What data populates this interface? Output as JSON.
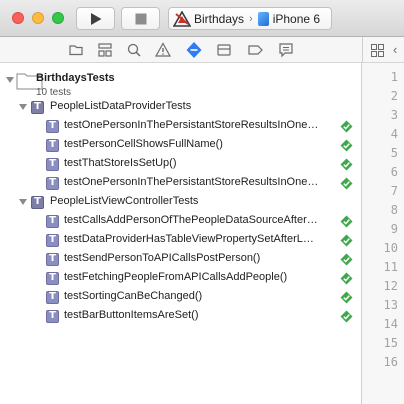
{
  "toolbar": {
    "scheme_name": "Birthdays",
    "device_name": "iPhone 6"
  },
  "navigator_icons": [
    "folder-icon",
    "hierarchy-icon",
    "magnifier-icon",
    "warning-icon",
    "test-diamond-icon",
    "debug-icon",
    "breakpoint-icon",
    "report-icon"
  ],
  "project": {
    "name": "BirthdaysTests",
    "count_label": "10 tests"
  },
  "groups": [
    {
      "name": "PeopleListDataProviderTests",
      "tests": [
        "testOnePersonInThePersistantStoreResultsInOne…",
        "testPersonCellShowsFullName()",
        "testThatStoreIsSetUp()",
        "testOnePersonInThePersistantStoreResultsInOne…"
      ]
    },
    {
      "name": "PeopleListViewControllerTests",
      "tests": [
        "testCallsAddPersonOfThePeopleDataSourceAfter…",
        "testDataProviderHasTableViewPropertySetAfterL…",
        "testSendPersonToAPICallsPostPerson()",
        "testFetchingPeopleFromAPICallsAddPeople()",
        "testSortingCanBeChanged()",
        "testBarButtonItemsAreSet()"
      ]
    }
  ],
  "line_numbers": [
    "1",
    "2",
    "3",
    "4",
    "5",
    "6",
    "7",
    "8",
    "9",
    "10",
    "11",
    "12",
    "13",
    "14",
    "15",
    "16"
  ],
  "colors": {
    "pass_green": "#3fa84c",
    "active_icon_blue": "#2f7cf6",
    "test_icon_purple": "#8b8ec0"
  }
}
